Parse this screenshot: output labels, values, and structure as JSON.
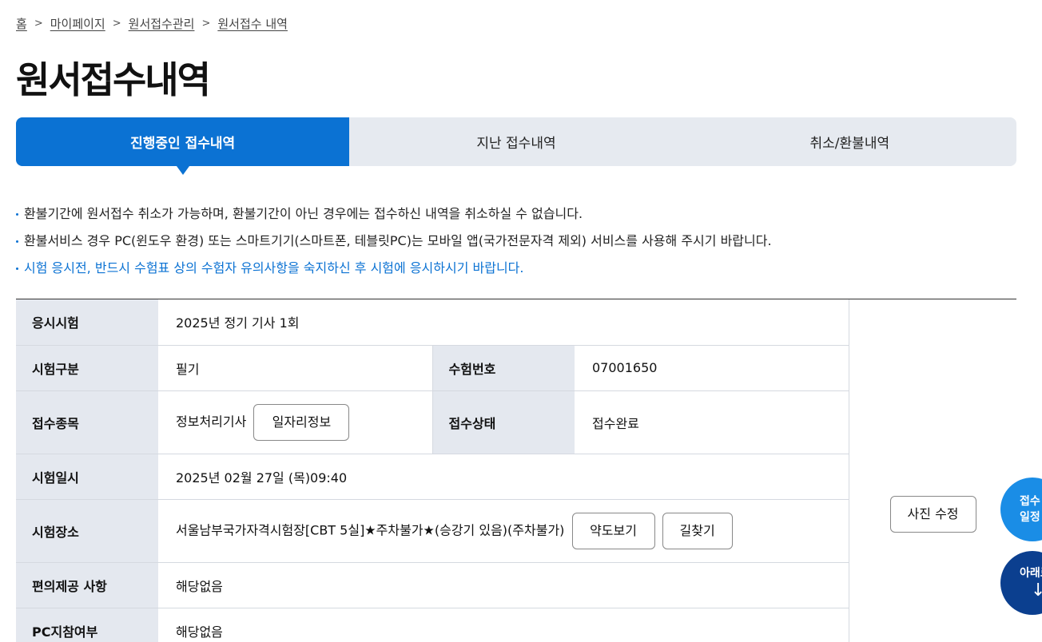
{
  "breadcrumb": {
    "items": [
      "홈",
      "마이페이지",
      "원서접수관리",
      "원서접수 내역"
    ]
  },
  "page_title": "원서접수내역",
  "tabs": [
    {
      "label": "진행중인 접수내역",
      "active": true
    },
    {
      "label": "지난 접수내역",
      "active": false
    },
    {
      "label": "취소/환불내역",
      "active": false
    }
  ],
  "notices": [
    "환불기간에 원서접수 취소가 가능하며, 환불기간이 아닌 경우에는 접수하신 내역을 취소하실 수 없습니다.",
    "환불서비스 경우 PC(윈도우 환경) 또는 스마트기기(스마트폰, 테블릿PC)는 모바일 앱(국가전문자격 제외) 서비스를 사용해 주시기 바랍니다.",
    "시험 응시전, 반드시 수험표 상의 수험자 유의사항을 숙지하신 후 시험에 응시하시기 바랍니다."
  ],
  "exam": {
    "exam_label": "응시시험",
    "exam_value": "2025년 정기 기사 1회",
    "type_label": "시험구분",
    "type_value": "필기",
    "number_label": "수험번호",
    "number_value": "07001650",
    "category_label": "접수종목",
    "category_value": "정보처리기사",
    "job_info_button": "일자리정보",
    "status_label": "접수상태",
    "status_value": "접수완료",
    "datetime_label": "시험일시",
    "datetime_value": "2025년 02월 27일 (목)09:40",
    "place_label": "시험장소",
    "place_value": "서울남부국가자격시험장[CBT 5실]★주차불가★(승강기 있음)(주차불가)",
    "map_button": "약도보기",
    "directions_button": "길찾기",
    "convenience_label": "편의제공 사항",
    "convenience_value": "해당없음",
    "pc_label": "PC지참여부",
    "pc_value": "해당없음"
  },
  "photo_edit_button": "사진 수정",
  "floating": {
    "schedule_line1": "접수",
    "schedule_line2": "일정",
    "down_label": "아래로",
    "down_arrow": "↓"
  },
  "colors": {
    "accent": "#0b72d3",
    "status": "#0033dd",
    "header_bg": "#e4e8ef"
  }
}
